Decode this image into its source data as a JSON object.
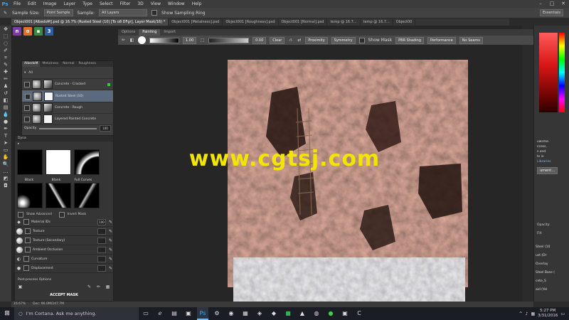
{
  "menubar": {
    "app_icon": "Ps",
    "items": [
      "File",
      "Edit",
      "Image",
      "Layer",
      "Type",
      "Select",
      "Filter",
      "3D",
      "View",
      "Window",
      "Help"
    ]
  },
  "optionsbar": {
    "sample_size_label": "Sample Size:",
    "sample_size_value": "Point Sample",
    "sample_label": "Sample:",
    "sample_value": "All Layers",
    "show_ring_label": "Show Sampling Ring",
    "workspace": "Essentials"
  },
  "tabs": [
    {
      "label": "Object001 [AlbedoM].psd @ 16.7% (Rusted Steel (10) [To o8 DFgr], Layer Mask/16) *",
      "active": true
    },
    {
      "label": "Object001 [Metalness].psd",
      "active": false
    },
    {
      "label": "Object001 [Roughness].psd",
      "active": false
    },
    {
      "label": "Object001 [Normal].psd",
      "active": false
    },
    {
      "label": "temp @ 16.7...",
      "active": false
    },
    {
      "label": "temp @ 16.7...",
      "active": false
    },
    {
      "label": "Object00",
      "active": false
    }
  ],
  "plugin": {
    "tabs": [
      "Options",
      "Painting",
      "Import"
    ],
    "brush_size": "1.00",
    "opacity": "0.00",
    "clear_label": "Clear",
    "proximity_label": "Proximity",
    "symmetry_label": "Symmetry",
    "show_mask_label": "Show Mask",
    "pbr_label": "PBR Shading",
    "performance_label": "Performance",
    "seams_label": "No Seams"
  },
  "material_panel": {
    "tabs": [
      "AlbedoM",
      "Metalness",
      "Normal",
      "Roughness"
    ],
    "group_label": "All",
    "layers": [
      {
        "name": "Concrete - Cracked",
        "selected": false
      },
      {
        "name": "Rusted Steel (10)",
        "selected": true
      },
      {
        "name": "Concrete - Rough",
        "selected": false
      },
      {
        "name": "Layered Painted Concrete",
        "selected": false
      }
    ],
    "opacity_label": "Opacity",
    "opacity_value": "100"
  },
  "dyn_panel": {
    "header": "Dyna",
    "swatches": [
      "Black",
      "Blank",
      "Full Curves"
    ],
    "show_advanced": "Show Advanced",
    "invert_mask": "Invert Mask",
    "channels": [
      {
        "name": "Material IDs",
        "value": "100"
      },
      {
        "name": "Texture",
        "value": ""
      },
      {
        "name": "Texture (Secondary)",
        "value": ""
      },
      {
        "name": "Ambient Occlusion",
        "value": ""
      },
      {
        "name": "Curvature",
        "value": ""
      },
      {
        "name": "Displacement",
        "value": ""
      }
    ],
    "post_process": "Post-process Options",
    "accept_mask": "ACCEPT MASK"
  },
  "right_panel": {
    "lines": [
      "vwsme.",
      "ccess,",
      "s and",
      "ts in",
      "Libraries",
      "ument..."
    ],
    "layer_names": [
      "Steel (10",
      "ust (Dr",
      "Overlay",
      "Steel Base (",
      "cete_S",
      "aid (Yel"
    ],
    "opacity": "Opacity:",
    "fill": "Fill:"
  },
  "watermark": "www.cgtsj.com",
  "statusbar": {
    "zoom": "16.67%",
    "doc": "Doc: 96.0M/247.7M"
  },
  "taskbar": {
    "search_placeholder": "I'm Cortana. Ask me anything.",
    "time": "5:27 PM",
    "date": "3/31/2016"
  },
  "colors": {
    "accent_ps": "#31a8ff",
    "watermark": "#f2e600",
    "selected_layer": "#5b6a7e"
  }
}
